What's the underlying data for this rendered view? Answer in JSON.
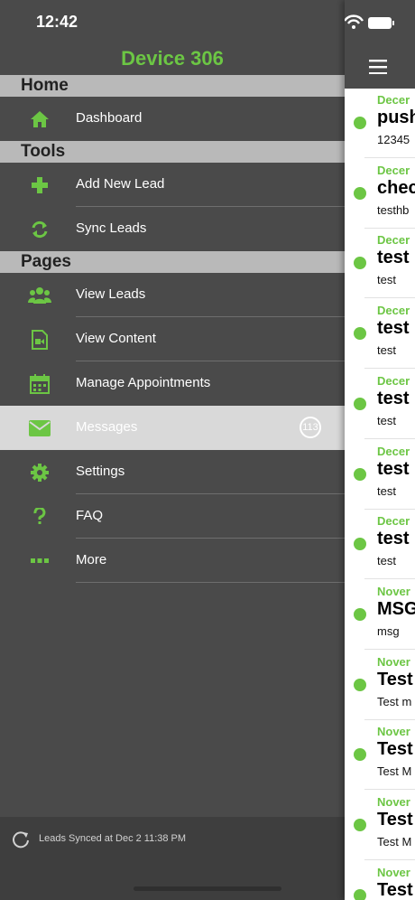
{
  "status_bar": {
    "time": "12:42"
  },
  "drawer": {
    "title": "Device 306",
    "sections": {
      "home": "Home",
      "tools": "Tools",
      "pages": "Pages"
    },
    "items": {
      "dashboard": "Dashboard",
      "add_new_lead": "Add New Lead",
      "sync_leads": "Sync Leads",
      "view_leads": "View Leads",
      "view_content": "View Content",
      "manage_appointments": "Manage Appointments",
      "messages": "Messages",
      "messages_badge": "113",
      "settings": "Settings",
      "faq": "FAQ",
      "more": "More"
    },
    "footer": {
      "sync_text": "Leads Synced at Dec 2 11:38 PM"
    },
    "colors": {
      "accent": "#6cc644",
      "drawer_bg": "#4a4a4a",
      "section_bg": "#b9b9b9"
    }
  },
  "messages_panel": {
    "rows": [
      {
        "date": "Decer",
        "subject": "push",
        "preview": "12345"
      },
      {
        "date": "Decer",
        "subject": "chec",
        "preview": "testhb"
      },
      {
        "date": "Decer",
        "subject": "test",
        "preview": "test"
      },
      {
        "date": "Decer",
        "subject": "test",
        "preview": "test"
      },
      {
        "date": "Decer",
        "subject": "test",
        "preview": "test"
      },
      {
        "date": "Decer",
        "subject": "test",
        "preview": "test"
      },
      {
        "date": "Decer",
        "subject": "test",
        "preview": "test"
      },
      {
        "date": "Nover",
        "subject": "MSG",
        "preview": "msg"
      },
      {
        "date": "Nover",
        "subject": "Test",
        "preview": "Test m"
      },
      {
        "date": "Nover",
        "subject": "Test",
        "preview": "Test M"
      },
      {
        "date": "Nover",
        "subject": "Test",
        "preview": "Test M"
      },
      {
        "date": "Nover",
        "subject": "Test",
        "preview": ""
      }
    ]
  }
}
